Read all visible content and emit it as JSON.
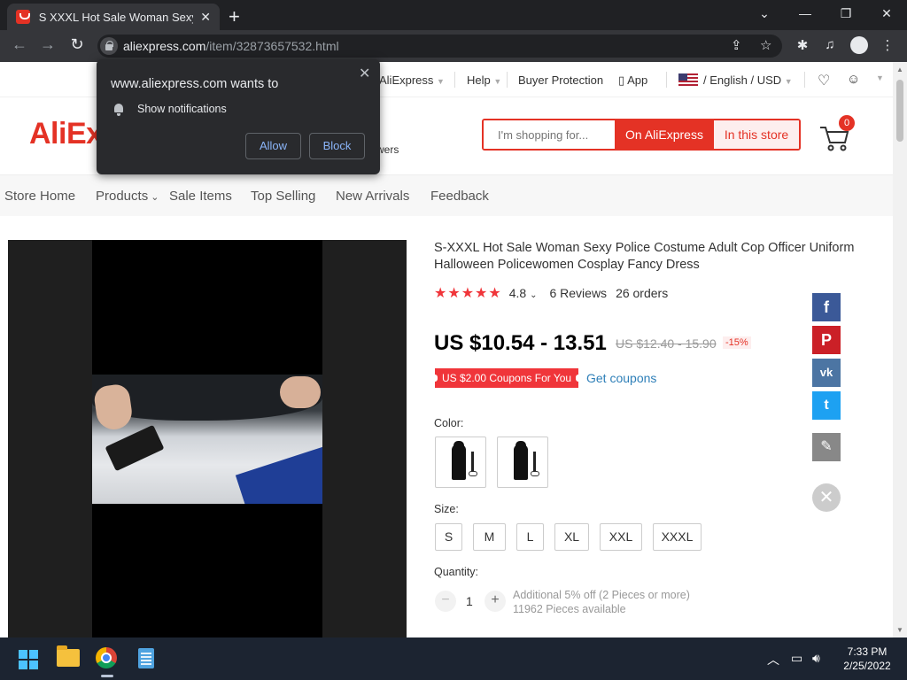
{
  "browser": {
    "tab_title": "S XXXL Hot Sale Woman Sexy Po",
    "url_domain": "aliexpress.com",
    "url_path": "/item/32873657532.html"
  },
  "popup": {
    "title": "www.aliexpress.com wants to",
    "permission": "Show notifications",
    "allow": "Allow",
    "block": "Block"
  },
  "topbar": {
    "aliexpress": "AliExpress",
    "help": "Help",
    "buyer_protection": "Buyer Protection",
    "app": "App",
    "language_currency": "/ English /  USD"
  },
  "header": {
    "logo": "AliEx",
    "followers_fragment": "wers",
    "search_placeholder": "I'm shopping for...",
    "btn_aliexpress": "On AliExpress",
    "btn_store": "In this store",
    "cart_count": "0"
  },
  "storenav": [
    "Store Home",
    "Products",
    "Sale Items",
    "Top Selling",
    "New Arrivals",
    "Feedback"
  ],
  "product": {
    "title": "S-XXXL Hot Sale Woman Sexy Police Costume Adult Cop Officer Uniform Halloween Policewomen Cosplay Fancy Dress",
    "rating": "4.8",
    "reviews": "6 Reviews",
    "orders": "26 orders",
    "price": "US $10.54 - 13.51",
    "old_price": "US $12.40 - 15.90",
    "discount": "-15%",
    "coupon": "US $2.00 Coupons For You",
    "get_coupons": "Get coupons",
    "color_label": "Color:",
    "size_label": "Size:",
    "sizes": [
      "S",
      "M",
      "L",
      "XL",
      "XXL",
      "XXXL"
    ],
    "quantity_label": "Quantity:",
    "quantity": "1",
    "qty_note1": "Additional 5% off (2 Pieces or more)",
    "qty_note2": "11962 Pieces available"
  },
  "share": {
    "facebook_color": "#3b5998",
    "pinterest_color": "#cb2027",
    "vk_color": "#4c75a3",
    "twitter_color": "#1da1f2",
    "edit_color": "#888888"
  },
  "taskbar": {
    "time": "7:33 PM",
    "date": "2/25/2022"
  }
}
